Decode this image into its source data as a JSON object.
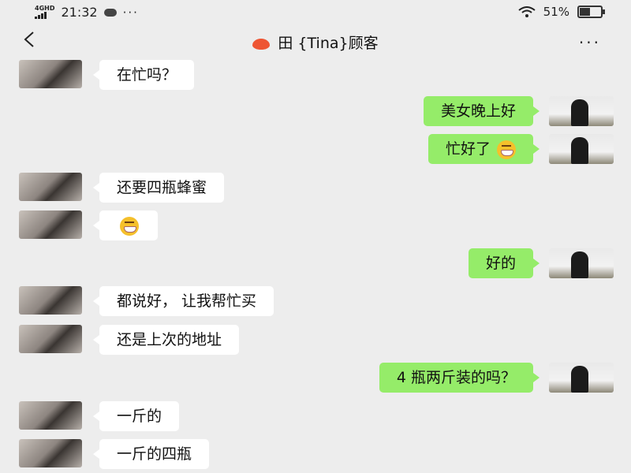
{
  "status": {
    "network": "4GHD",
    "time": "21:32",
    "more": "···",
    "battery": "51%",
    "battery_level": 0.51
  },
  "nav": {
    "title": "田 {Tina}顾客",
    "more": "···"
  },
  "messages": [
    {
      "side": "in",
      "text": "在忙吗？"
    },
    {
      "side": "out",
      "text": "美女晚上好"
    },
    {
      "side": "out",
      "text": "忙好了",
      "emoji": "grin-icon"
    },
    {
      "side": "in",
      "text": "还要四瓶蜂蜜"
    },
    {
      "side": "in",
      "text": "",
      "emoji": "grin-icon"
    },
    {
      "side": "out",
      "text": "好的"
    },
    {
      "side": "in",
      "text": "都说好， 让我帮忙买"
    },
    {
      "side": "in",
      "text": "还是上次的地址"
    },
    {
      "side": "out",
      "text": "4 瓶两斤装的吗？"
    },
    {
      "side": "in",
      "text": "一斤的"
    },
    {
      "side": "in",
      "text": "一斤的四瓶"
    }
  ],
  "colors": {
    "background": "#ededed",
    "bubble_out": "#95ec69",
    "bubble_in": "#ffffff"
  }
}
